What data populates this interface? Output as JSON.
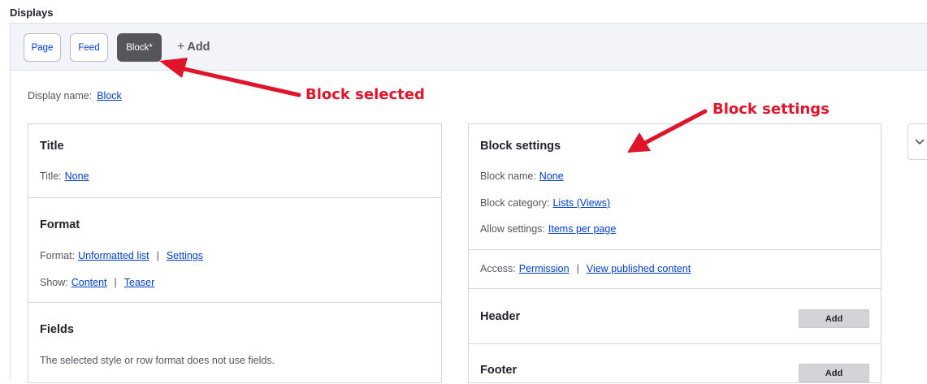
{
  "displays_heading": "Displays",
  "tabs": [
    {
      "label": "Page",
      "active": false
    },
    {
      "label": "Feed",
      "active": false
    },
    {
      "label": "Block*",
      "active": true
    }
  ],
  "add_display": {
    "plus": "+",
    "label": "Add"
  },
  "display_name": {
    "label": "Display name:",
    "value": "Block"
  },
  "left_column": {
    "title_section": {
      "heading": "Title",
      "label": "Title:",
      "value": "None"
    },
    "format_section": {
      "heading": "Format",
      "format_label": "Format:",
      "format_value": "Unformatted list",
      "format_settings": "Settings",
      "show_label": "Show:",
      "show_value": "Content",
      "show_teaser": "Teaser"
    },
    "fields_section": {
      "heading": "Fields",
      "note": "The selected style or row format does not use fields."
    }
  },
  "right_column": {
    "block_settings": {
      "heading": "Block settings",
      "block_name_label": "Block name:",
      "block_name_value": "None",
      "category_label": "Block category:",
      "category_value": "Lists (Views)",
      "allow_label": "Allow settings:",
      "allow_value": "Items per page"
    },
    "access": {
      "label": "Access:",
      "permission": "Permission",
      "view": "View published content"
    },
    "header": {
      "heading": "Header",
      "button": "Add"
    },
    "footer": {
      "heading": "Footer",
      "button": "Add"
    }
  },
  "separator": "|",
  "annotations": {
    "block_selected": "Block selected",
    "block_settings": "Block settings"
  },
  "colors": {
    "annotation": "#e0142a",
    "link": "#003ecc",
    "active_tab": "#55565b"
  },
  "icons": {
    "collapse": "chevron-down-icon"
  }
}
